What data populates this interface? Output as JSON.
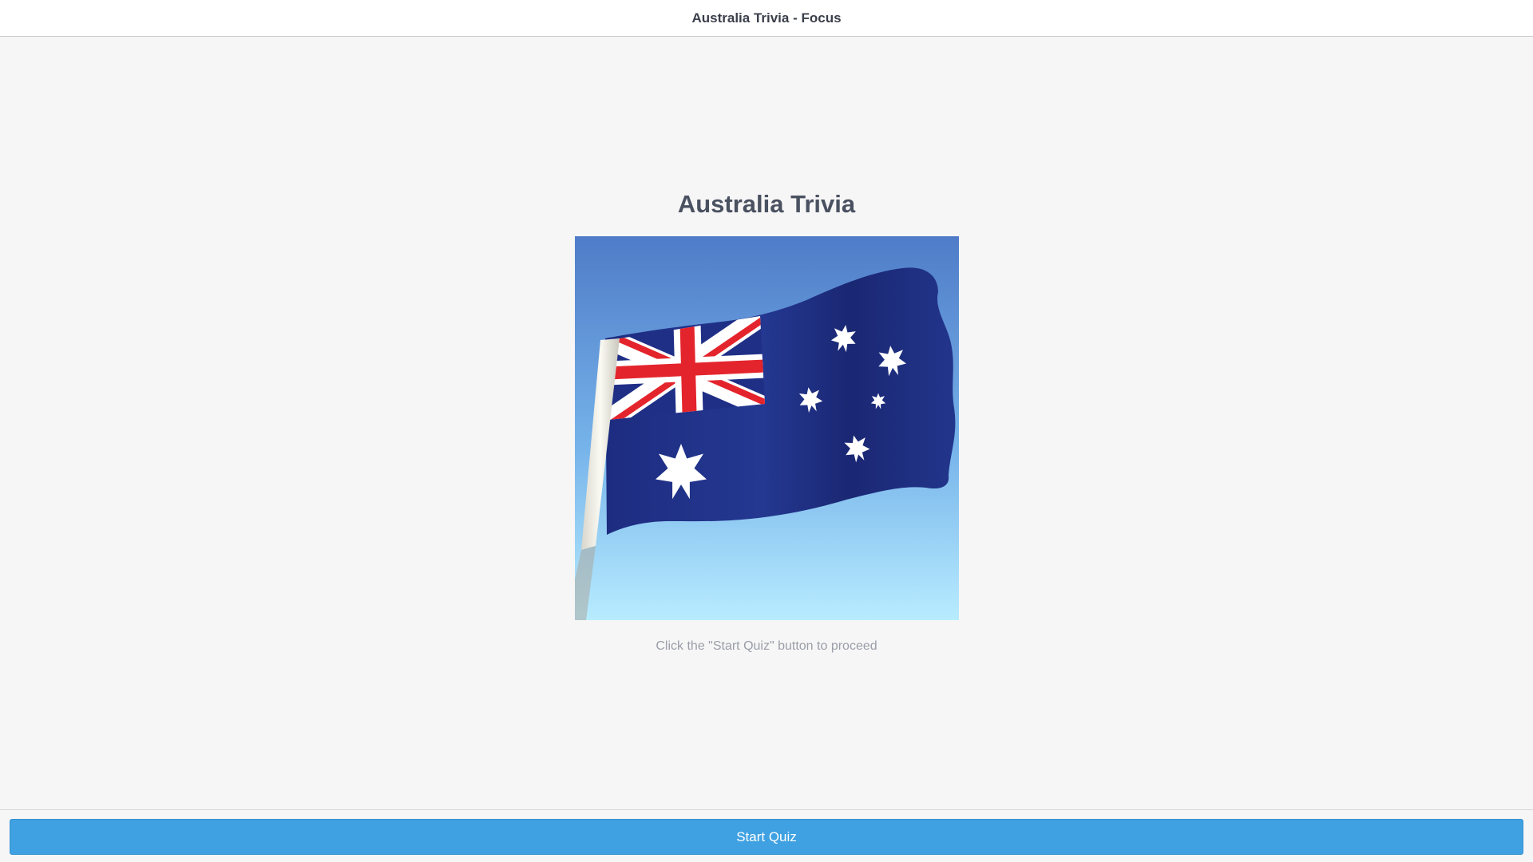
{
  "header": {
    "title": "Australia Trivia - Focus"
  },
  "main": {
    "title": "Australia Trivia",
    "image": {
      "icon": "australian-flag-image",
      "sky_colors": [
        "#4f7cc8",
        "#b8ecff"
      ],
      "flag_colors": {
        "navy": "#1f2f86",
        "red": "#e4242c",
        "white": "#ffffff"
      }
    },
    "hint": "Click the \"Start Quiz\" button to proceed"
  },
  "footer": {
    "start_button_label": "Start Quiz",
    "button_color": "#3fa1e2"
  }
}
